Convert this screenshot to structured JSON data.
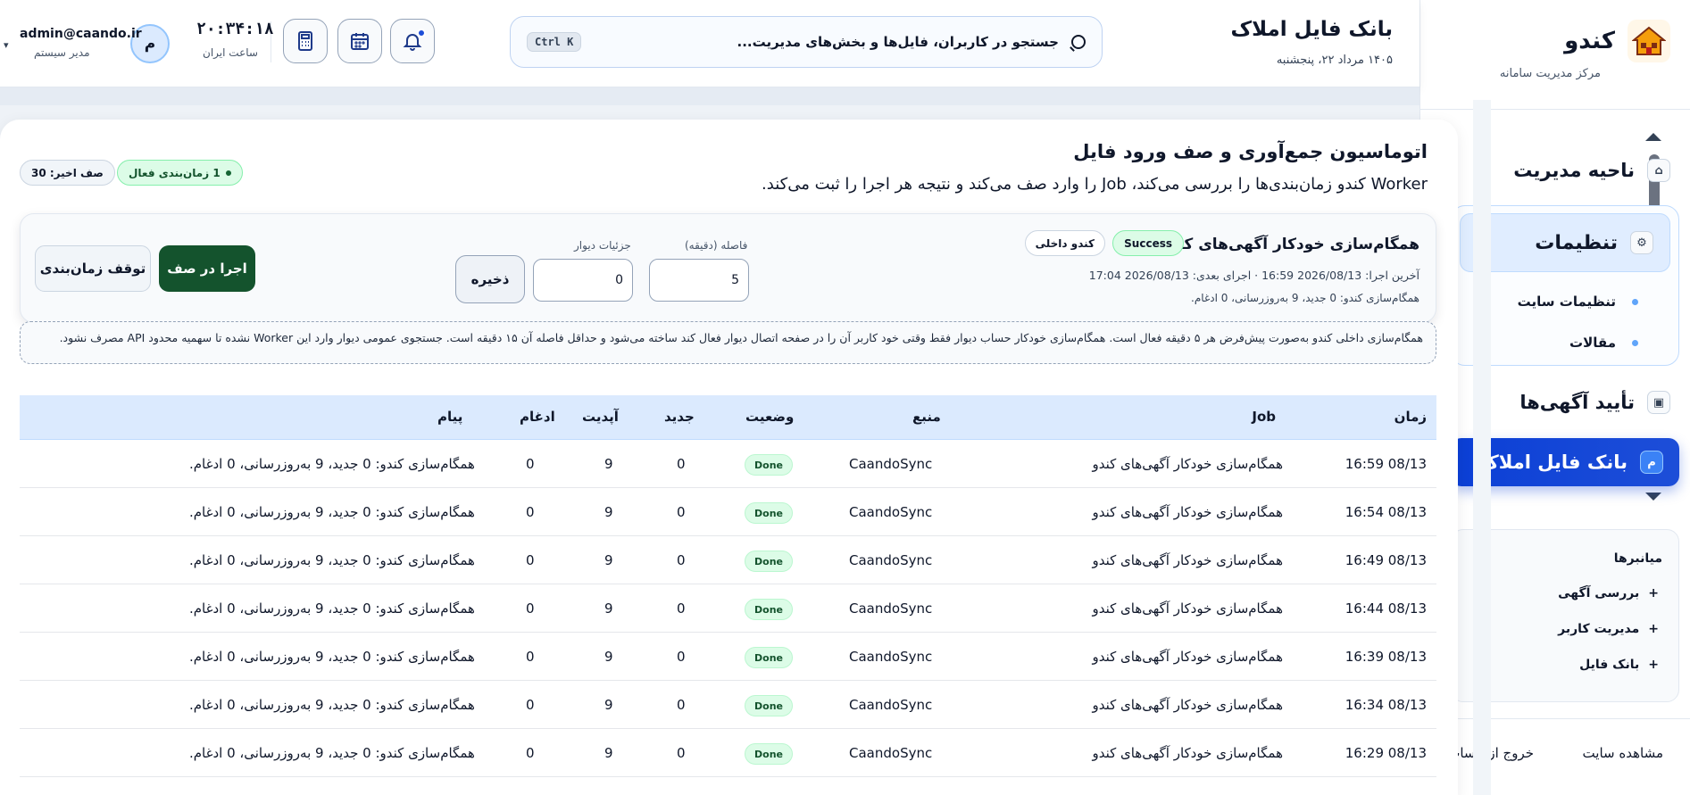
{
  "sidebar": {
    "brand_name": "کندو",
    "brand_sub": "مرکز مدیریت سامانه",
    "nav": {
      "admin_area": "ناحیه مدیریت",
      "settings": "تنظیمات",
      "site_settings": "تنظیمات سایت",
      "articles": "مقالات",
      "ad_approval": "تأیید آگهی‌ها",
      "property_bank": "بانک فایل املاک"
    },
    "shortcuts": {
      "title": "میانبرها",
      "items": [
        "بررسی آگهی",
        "مدیریت کاربر",
        "بانک فایل"
      ]
    },
    "footer": {
      "view_site": "مشاهده سایت",
      "logout": "خروج از حساب"
    }
  },
  "header": {
    "title": "بانک فایل املاک",
    "date": "۱۴۰۵ مرداد ۲۲، پنجشنبه",
    "search_placeholder": "جستجو در کاربران، فایل‌ها و بخش‌های مدیریت...",
    "search_shortcut": "Ctrl K",
    "clock": "۲۰:۳۴:۱۸",
    "clock_label": "ساعت ایران",
    "avatar_letter": "م",
    "user_email": "admin@caando.ir",
    "user_role": "مدیر سیستم"
  },
  "panel": {
    "title": "اتوماسیون جمع‌آوری و صف ورود فایل",
    "desc": "Worker کندو زمان‌بندی‌ها را بررسی می‌کند، Job را وارد صف می‌کند و نتیجه هر اجرا را ثبت می‌کند.",
    "active_schedules": "1 زمان‌بندی فعال",
    "recent_queue": "صف اخیر: 30"
  },
  "job": {
    "title": "همگام‌سازی خودکار آگهی‌های کندو",
    "status": "Success",
    "source": "کندو داخلی",
    "meta": "آخرین اجرا: 2026/08/13 16:59 · اجرای بعدی: 2026/08/13 17:04",
    "result": "همگام‌سازی کندو: 0 جدید، 9 به‌روزرسانی، 0 ادغام.",
    "interval_label": "فاصله (دقیقه)",
    "interval_value": "5",
    "divar_label": "جزئیات دیوار",
    "divar_value": "0",
    "save": "ذخیره",
    "run": "اجرا در صف",
    "stop": "توقف زمان‌بندی"
  },
  "note": "همگام‌سازی داخلی کندو به‌صورت پیش‌فرض هر ۵ دقیقه فعال است. همگام‌سازی خودکار حساب دیوار فقط وقتی خود کاربر آن را در صفحه اتصال دیوار فعال کند ساخته می‌شود و حداقل فاصله آن ۱۵ دقیقه است. جستجوی عمومی دیوار وارد این Worker نشده تا سهمیه محدود API مصرف نشود.",
  "table": {
    "headers": {
      "time": "زمان",
      "job": "Job",
      "source": "منبع",
      "status": "وضعیت",
      "new": "جدید",
      "updated": "آپدیت",
      "merged": "ادغام",
      "message": "پیام"
    },
    "rows": [
      {
        "time": "16:59 08/13",
        "job": "همگام‌سازی خودکار آگهی‌های کندو",
        "source": "CaandoSync",
        "status": "Done",
        "new": "0",
        "updated": "9",
        "merged": "0",
        "message": "همگام‌سازی کندو: 0 جدید، 9 به‌روزرسانی، 0 ادغام."
      },
      {
        "time": "16:54 08/13",
        "job": "همگام‌سازی خودکار آگهی‌های کندو",
        "source": "CaandoSync",
        "status": "Done",
        "new": "0",
        "updated": "9",
        "merged": "0",
        "message": "همگام‌سازی کندو: 0 جدید، 9 به‌روزرسانی، 0 ادغام."
      },
      {
        "time": "16:49 08/13",
        "job": "همگام‌سازی خودکار آگهی‌های کندو",
        "source": "CaandoSync",
        "status": "Done",
        "new": "0",
        "updated": "9",
        "merged": "0",
        "message": "همگام‌سازی کندو: 0 جدید، 9 به‌روزرسانی، 0 ادغام."
      },
      {
        "time": "16:44 08/13",
        "job": "همگام‌سازی خودکار آگهی‌های کندو",
        "source": "CaandoSync",
        "status": "Done",
        "new": "0",
        "updated": "9",
        "merged": "0",
        "message": "همگام‌سازی کندو: 0 جدید، 9 به‌روزرسانی، 0 ادغام."
      },
      {
        "time": "16:39 08/13",
        "job": "همگام‌سازی خودکار آگهی‌های کندو",
        "source": "CaandoSync",
        "status": "Done",
        "new": "0",
        "updated": "9",
        "merged": "0",
        "message": "همگام‌سازی کندو: 0 جدید، 9 به‌روزرسانی، 0 ادغام."
      },
      {
        "time": "16:34 08/13",
        "job": "همگام‌سازی خودکار آگهی‌های کندو",
        "source": "CaandoSync",
        "status": "Done",
        "new": "0",
        "updated": "9",
        "merged": "0",
        "message": "همگام‌سازی کندو: 0 جدید، 9 به‌روزرسانی، 0 ادغام."
      },
      {
        "time": "16:29 08/13",
        "job": "همگام‌سازی خودکار آگهی‌های کندو",
        "source": "CaandoSync",
        "status": "Done",
        "new": "0",
        "updated": "9",
        "merged": "0",
        "message": "همگام‌سازی کندو: 0 جدید، 9 به‌روزرسانی، 0 ادغام."
      }
    ]
  },
  "colors": {
    "accent": "#1d4ed8",
    "success_bg": "#dcfce7",
    "run_button": "#14532d",
    "table_header": "#dbeafe"
  }
}
